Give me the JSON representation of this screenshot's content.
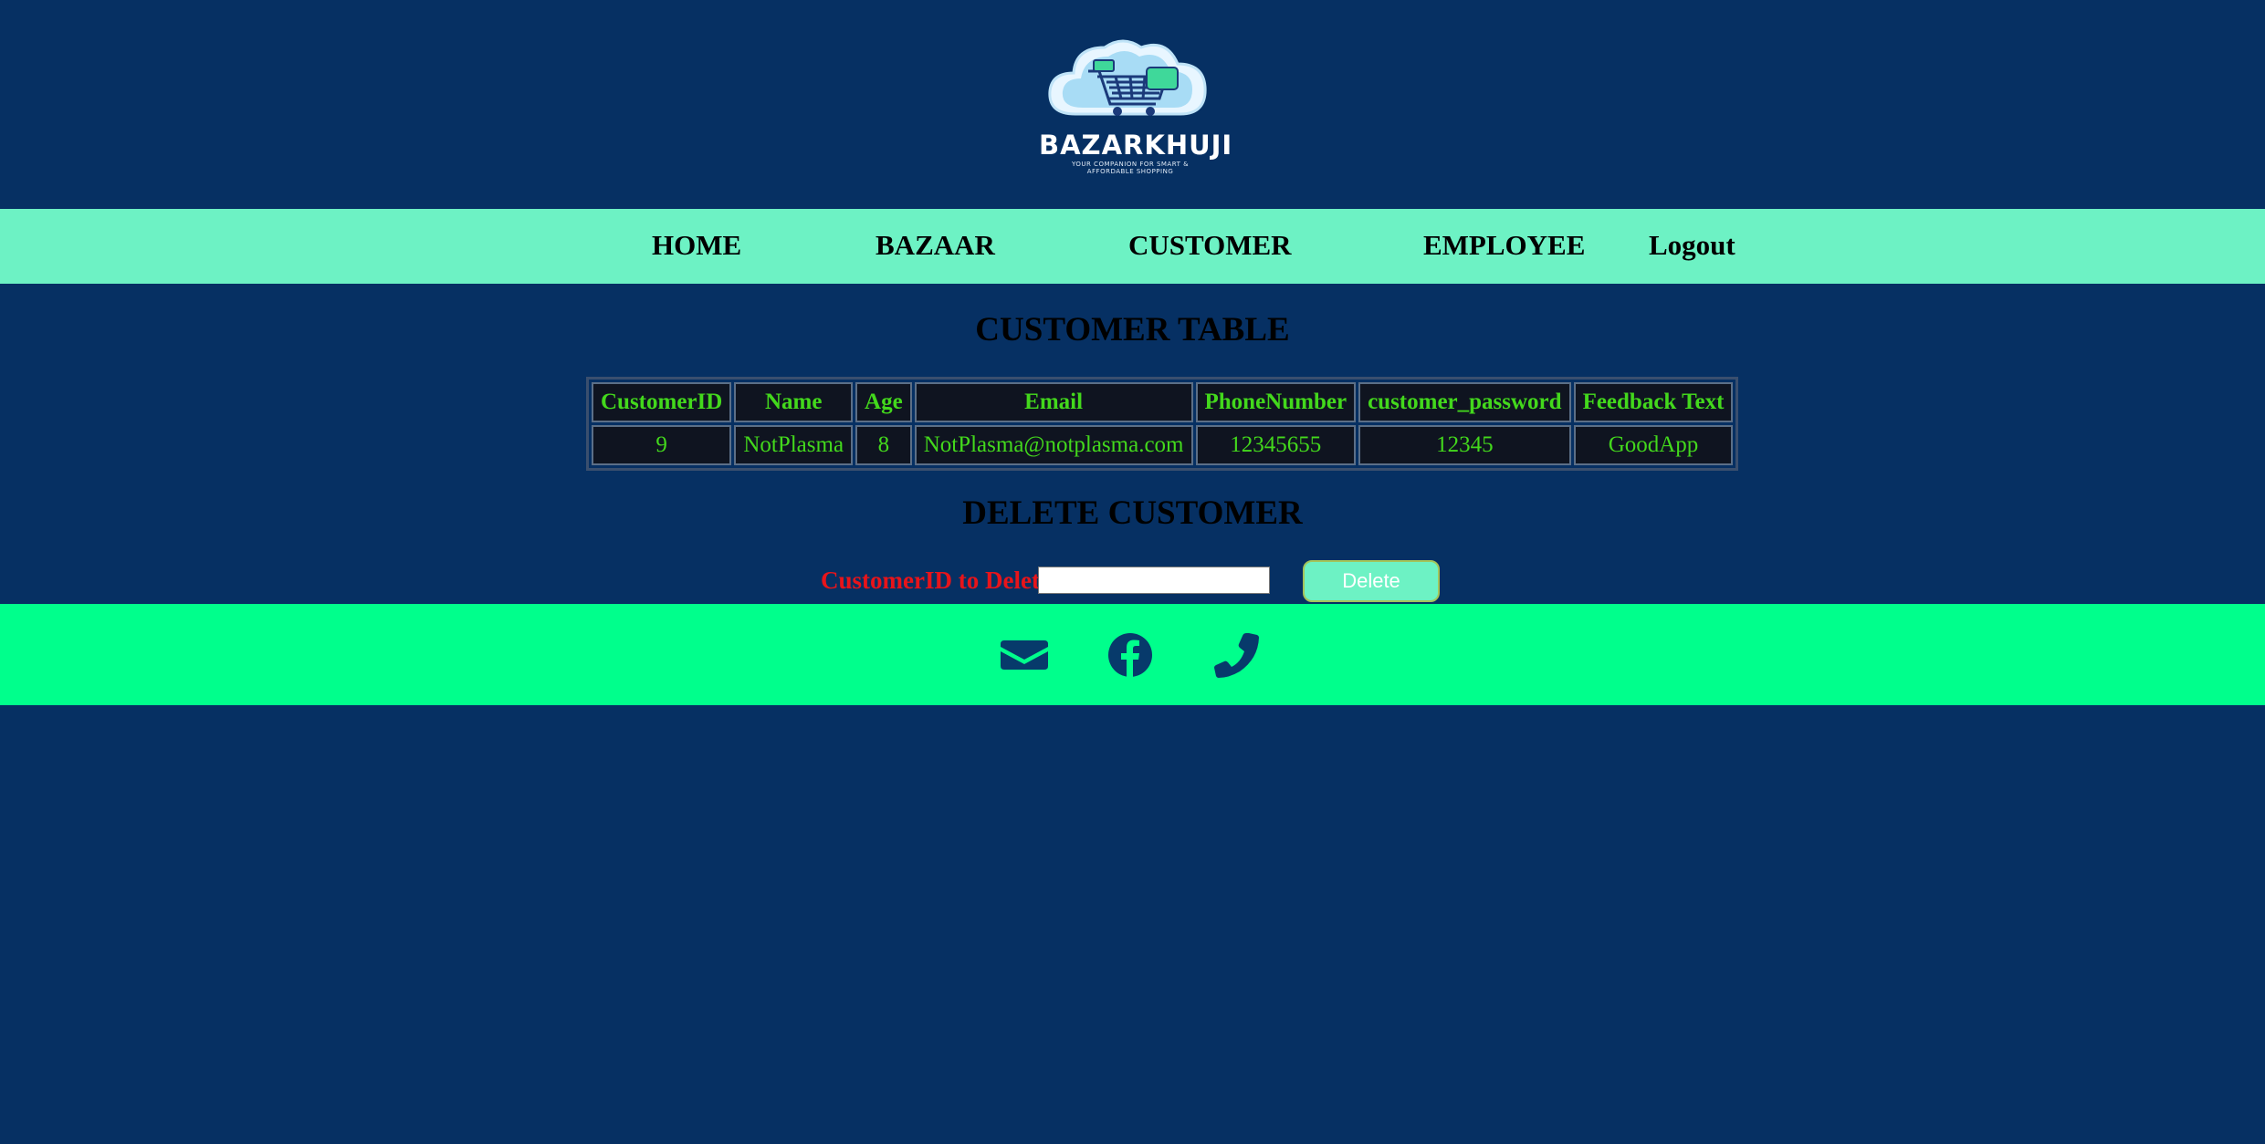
{
  "brand": {
    "name": "BAZARKHUJI",
    "tagline_line1": "YOUR COMPANION FOR SMART &",
    "tagline_line2": "AFFORDABLE SHOPPING"
  },
  "nav": {
    "items": [
      {
        "label": "HOME"
      },
      {
        "label": "BAZAAR"
      },
      {
        "label": "CUSTOMER"
      },
      {
        "label": "EMPLOYEE"
      },
      {
        "label": "Logout"
      }
    ]
  },
  "customer_table": {
    "title": "CUSTOMER TABLE",
    "columns": [
      "CustomerID",
      "Name",
      "Age",
      "Email",
      "PhoneNumber",
      "customer_password",
      "Feedback Text"
    ],
    "rows": [
      [
        "9",
        "NotPlasma",
        "8",
        "NotPlasma@notplasma.com",
        "12345655",
        "12345",
        "GoodApp"
      ]
    ]
  },
  "delete_form": {
    "title": "DELETE CUSTOMER",
    "label": "CustomerID to Delete:",
    "input_value": "",
    "button_label": "Delete"
  },
  "footer": {
    "icons": [
      "envelope-icon",
      "facebook-icon",
      "phone-icon"
    ]
  },
  "colors": {
    "page_bg": "#063063",
    "nav_bg": "#6df2c4",
    "footer_bg": "#00ff8c",
    "table_text": "#43d81c",
    "label_red": "#e8141a"
  }
}
